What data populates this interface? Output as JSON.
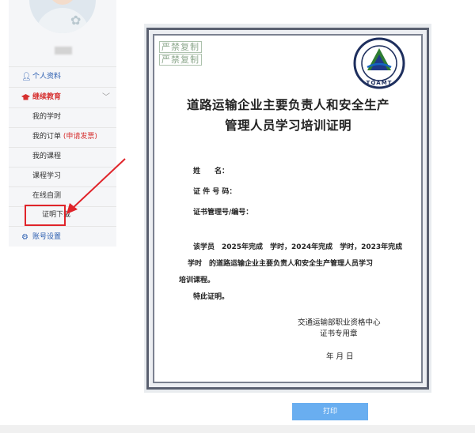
{
  "sidebar": {
    "items": [
      {
        "label": "个人资料",
        "icon": "user-icon"
      },
      {
        "label": "继续教育",
        "icon": "graduation-cap-icon"
      }
    ],
    "sub_items": [
      {
        "label": "我的学时"
      },
      {
        "label": "我的订单",
        "extra": "(申请发票)"
      },
      {
        "label": "我的课程"
      },
      {
        "label": "课程学习"
      },
      {
        "label": "在线自测"
      },
      {
        "label": "证明下载"
      }
    ],
    "account": {
      "label": "账号设置",
      "icon": "gear-icon"
    }
  },
  "certificate": {
    "watermark": [
      "严禁复制",
      "严禁复制"
    ],
    "seal_text": "TQAMT",
    "title_line1": "道路运输企业主要负责人和安全生产",
    "title_line2": "管理人员学习培训证明",
    "fields": [
      {
        "label": "姓　　名："
      },
      {
        "label": "证 件 号 码："
      },
      {
        "label": "证书管理号/编号："
      }
    ],
    "body_line1": "该学员　2025年完成　学时，2024年完成　学时，2023年完成",
    "body_line2": "学时　的道路运输企业主要负责人和安全生产管理人员学习",
    "body_line3": "培训课程。",
    "body_line4": "特此证明。",
    "issuer": "交通运输部职业资格中心",
    "seal_label": "证书专用章",
    "date": "年 月 日"
  },
  "actions": {
    "print_label": "打印"
  },
  "colors": {
    "accent_red": "#e0242a",
    "nav_blue": "#2a5db0",
    "button_blue": "#69aef0"
  }
}
